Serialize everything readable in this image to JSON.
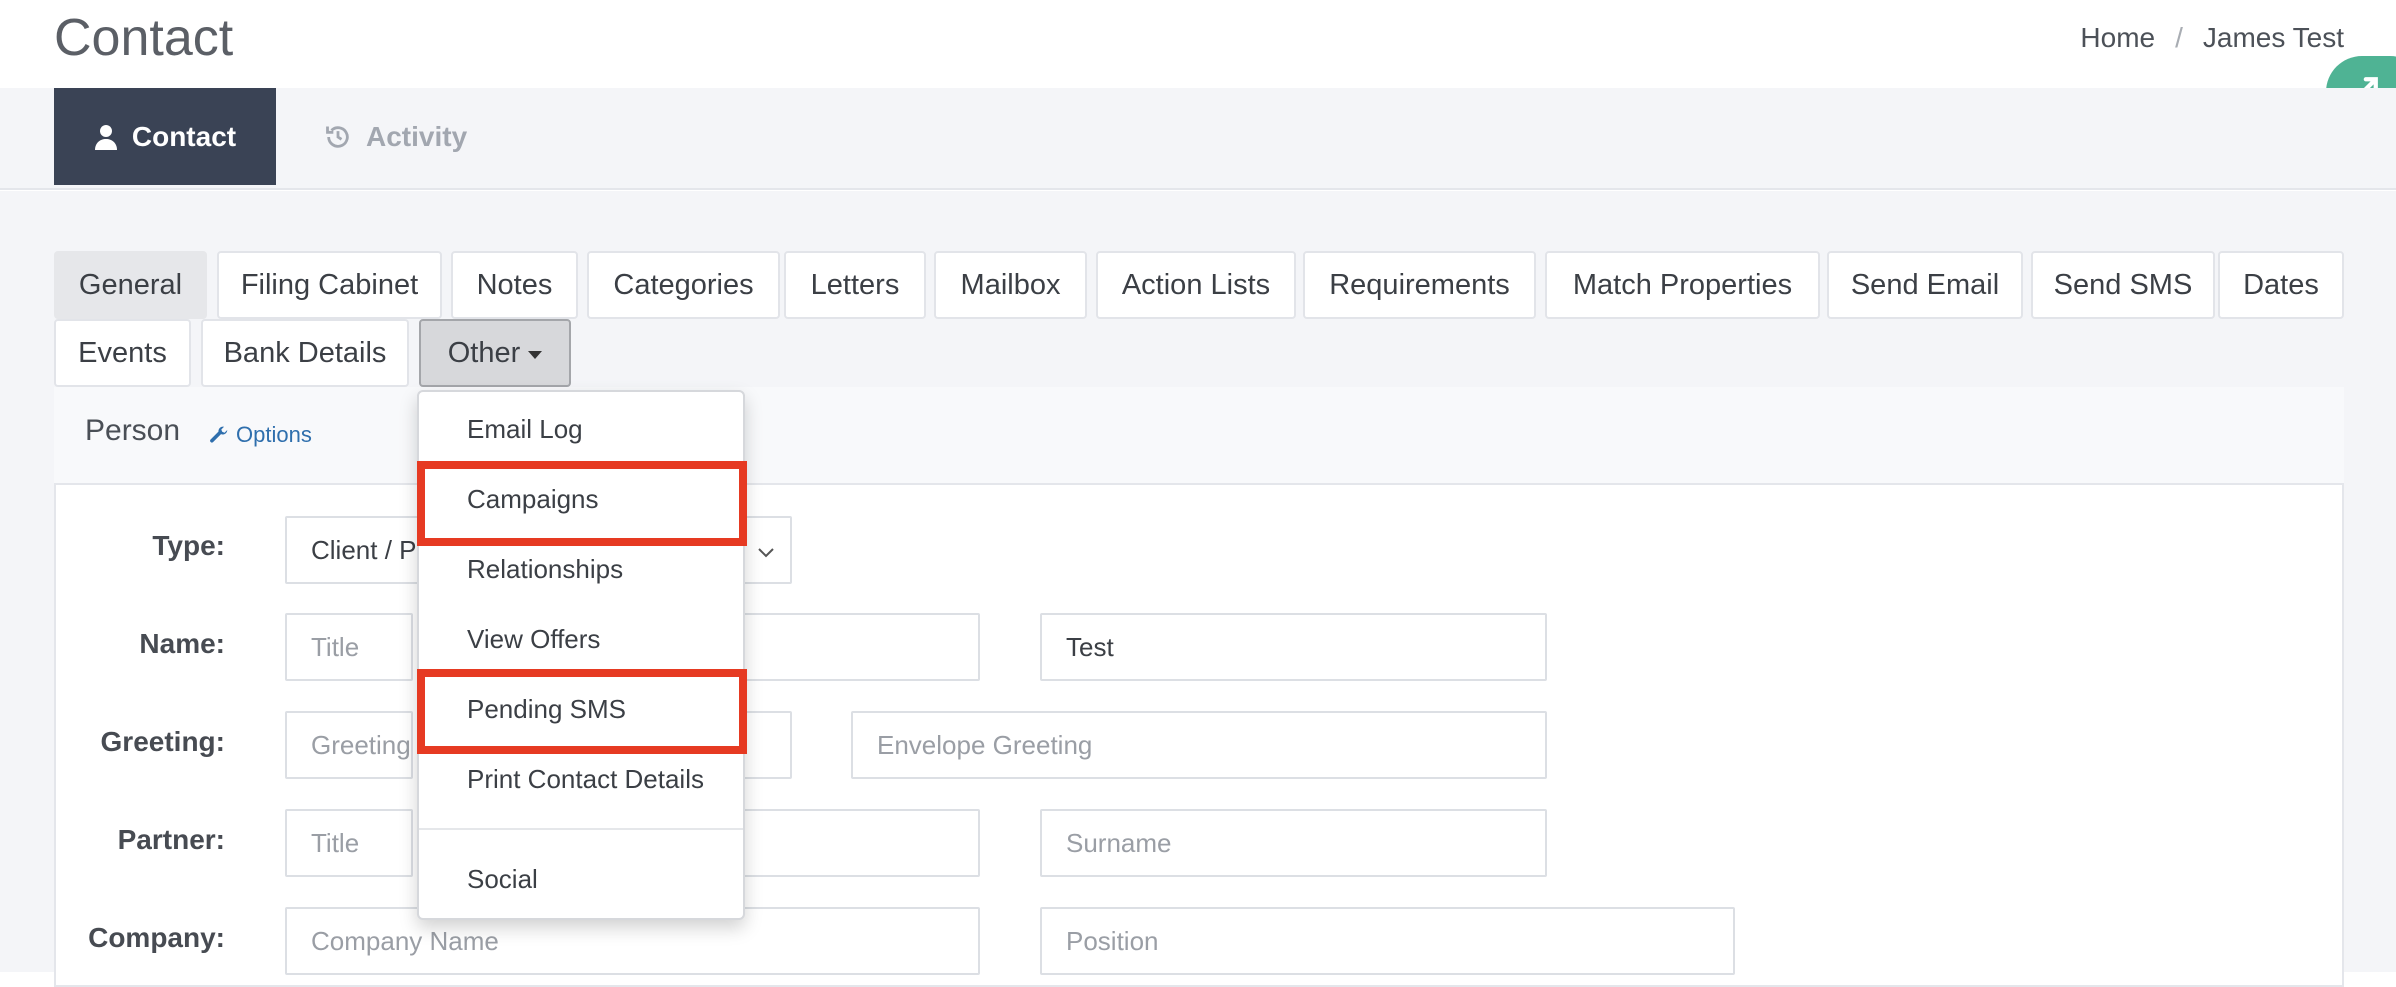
{
  "header": {
    "title": "Contact",
    "breadcrumb": [
      "Home",
      "James Test"
    ],
    "breadcrumb_separator": "/"
  },
  "top_tabs": [
    {
      "label": "Contact",
      "icon": "user-icon",
      "active": true
    },
    {
      "label": "Activity",
      "icon": "history-icon",
      "active": false
    }
  ],
  "sub_tabs": {
    "general": "General",
    "filing_cabinet": "Filing Cabinet",
    "notes": "Notes",
    "categories": "Categories",
    "letters": "Letters",
    "mailbox": "Mailbox",
    "action_lists": "Action Lists",
    "requirements": "Requirements",
    "match_properties": "Match Properties",
    "send_email": "Send Email",
    "send_sms": "Send SMS",
    "dates": "Dates",
    "events": "Events",
    "bank_details": "Bank Details",
    "other": "Other"
  },
  "panel": {
    "title": "Person",
    "options_label": "Options"
  },
  "form": {
    "type_label": "Type:",
    "type_value": "Client / P",
    "name_label": "Name:",
    "name_title_placeholder": "Title",
    "surname_value": "Test",
    "greeting_label": "Greeting:",
    "greeting_placeholder": "Greeting",
    "envelope_greeting_placeholder": "Envelope Greeting",
    "partner_label": "Partner:",
    "partner_title_placeholder": "Title",
    "partner_surname_placeholder": "Surname",
    "company_label": "Company:",
    "company_name_placeholder": "Company Name",
    "position_placeholder": "Position"
  },
  "other_menu": {
    "items": [
      "Email Log",
      "Campaigns",
      "Relationships",
      "View Offers",
      "Pending SMS",
      "Print Contact Details",
      "Social"
    ],
    "highlighted": [
      "Campaigns",
      "Pending SMS"
    ],
    "highlight_color": "#e63a22"
  },
  "colors": {
    "active_tab_bg": "#3a4355",
    "fab": "#4fb394",
    "link": "#2f6fad"
  }
}
